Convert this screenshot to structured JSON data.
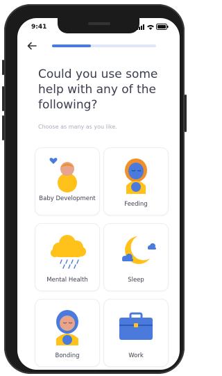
{
  "status_bar": {
    "time": "9:41"
  },
  "progress": {
    "fraction": 0.37
  },
  "question": {
    "title": "Could you use some help with any of the following?",
    "subtitle": "Choose as many as you like."
  },
  "options": [
    {
      "label": "Baby Development",
      "icon": "baby-icon"
    },
    {
      "label": "Feeding",
      "icon": "feeding-icon"
    },
    {
      "label": "Mental Health",
      "icon": "rain-cloud-icon"
    },
    {
      "label": "Sleep",
      "icon": "moon-icon"
    },
    {
      "label": "Bonding",
      "icon": "bonding-icon"
    },
    {
      "label": "Work",
      "icon": "briefcase-icon"
    }
  ],
  "colors": {
    "accent": "#4a7bdc",
    "yellow": "#ffc21a",
    "orange": "#f0902a",
    "skin": "#e8a58d"
  }
}
